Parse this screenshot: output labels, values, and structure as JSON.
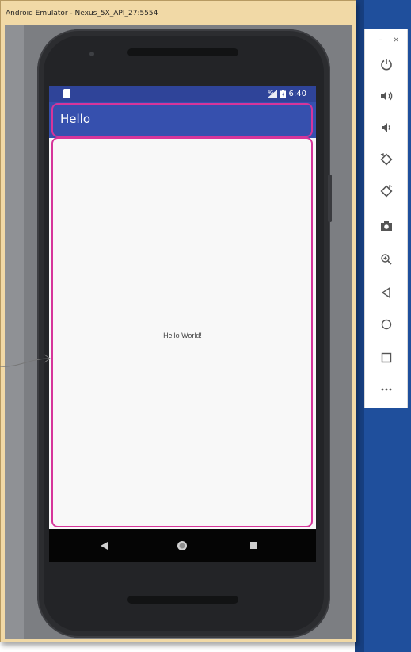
{
  "window": {
    "title": "Android Emulator - Nexus_5X_API_27:5554"
  },
  "status_bar": {
    "time": "6:40",
    "icons": [
      "sd-card-icon",
      "signal-icon",
      "battery-icon"
    ]
  },
  "app": {
    "title": "Hello",
    "content_text": "Hello World!"
  },
  "navigation": {
    "buttons": [
      "back-icon",
      "home-icon",
      "recents-icon"
    ]
  },
  "toolbar": {
    "minimize": "–",
    "close": "×",
    "items": [
      {
        "name": "power-button",
        "icon": "power-icon"
      },
      {
        "name": "volume-up-button",
        "icon": "volume-up-icon"
      },
      {
        "name": "volume-down-button",
        "icon": "volume-down-icon"
      },
      {
        "name": "rotate-left-button",
        "icon": "rotate-left-icon"
      },
      {
        "name": "rotate-right-button",
        "icon": "rotate-right-icon"
      },
      {
        "name": "screenshot-button",
        "icon": "camera-icon"
      },
      {
        "name": "zoom-button",
        "icon": "zoom-icon"
      },
      {
        "name": "back-button",
        "icon": "back-icon"
      },
      {
        "name": "home-button",
        "icon": "home-icon"
      },
      {
        "name": "overview-button",
        "icon": "overview-icon"
      },
      {
        "name": "more-button",
        "icon": "more-icon"
      }
    ]
  },
  "colors": {
    "status_bar": "#2f4499",
    "app_bar": "#3650ae",
    "highlight": "#d6359a",
    "window_frame": "#f1d9a6"
  }
}
